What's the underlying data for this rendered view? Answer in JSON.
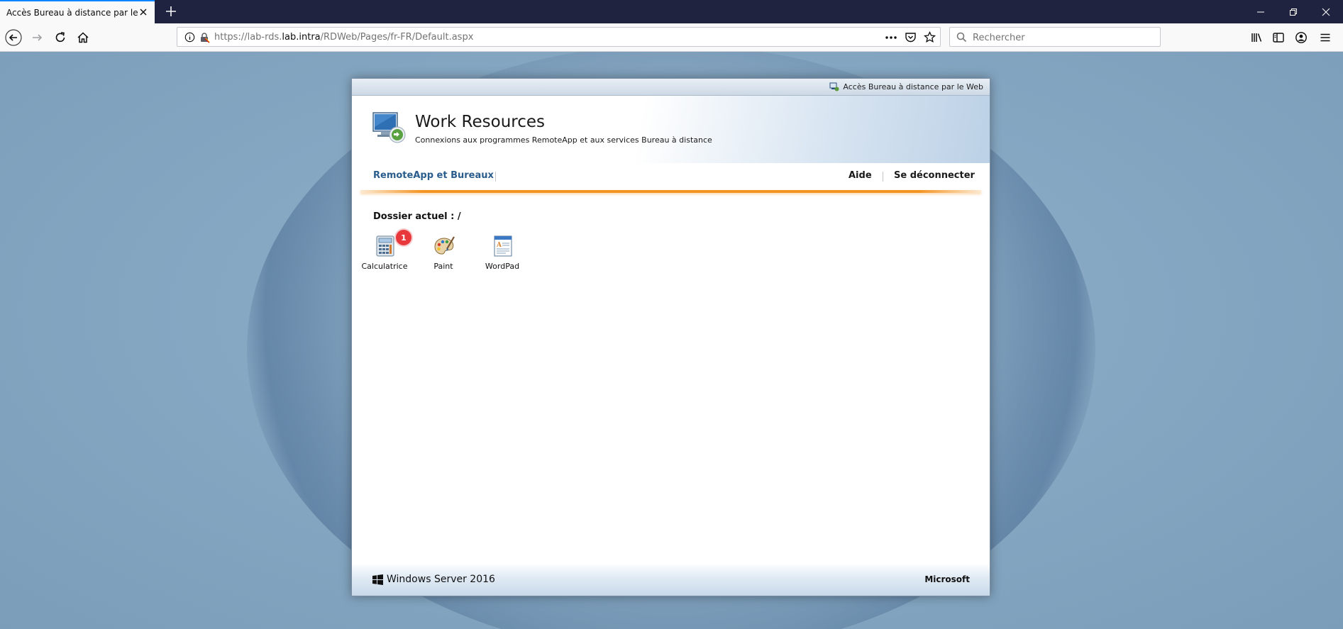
{
  "browser": {
    "tab_title": "Accès Bureau à distance par le Web",
    "url_prefix": "https://lab-rds.",
    "url_host": "lab.intra",
    "url_path": "/RDWeb/Pages/fr-FR/Default.aspx",
    "search_placeholder": "Rechercher"
  },
  "rdweb": {
    "top_strip_label": "Accès Bureau à distance par le Web",
    "title": "Work Resources",
    "subtitle": "Connexions aux programmes RemoteApp et aux services Bureau à distance",
    "nav": {
      "remoteapp_label": "RemoteApp et Bureaux",
      "help_label": "Aide",
      "logout_label": "Se déconnecter"
    },
    "current_folder": "Dossier actuel : /",
    "apps": [
      {
        "label": "Calculatrice",
        "icon": "calculator-icon"
      },
      {
        "label": "Paint",
        "icon": "paint-palette-icon"
      },
      {
        "label": "WordPad",
        "icon": "wordpad-icon"
      }
    ],
    "badge_count": "1",
    "footer_left": "Windows Server 2016",
    "footer_right": "Microsoft"
  },
  "colors": {
    "accent_orange": "#f39423",
    "nav_link_blue": "#2a5d8c",
    "badge_red": "#e8383b",
    "tab_accent": "#0a84ff"
  }
}
